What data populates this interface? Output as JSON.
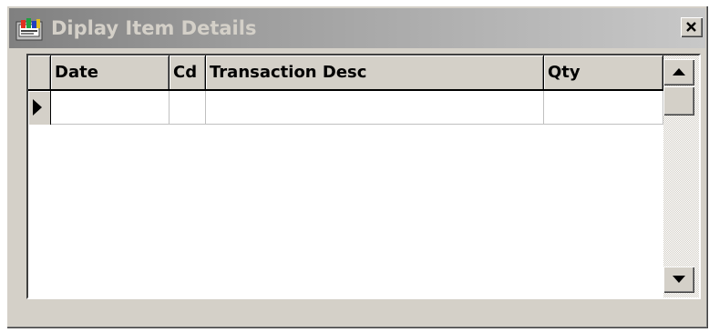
{
  "window": {
    "title": "Diplay Item Details",
    "icon": "app-icon",
    "close_label": "X"
  },
  "grid": {
    "columns": [
      {
        "key": "date",
        "label": "Date"
      },
      {
        "key": "cd",
        "label": "Cd"
      },
      {
        "key": "transaction_desc",
        "label": "Transaction Desc"
      },
      {
        "key": "qty",
        "label": "Qty"
      }
    ],
    "rows": [
      {
        "date": "",
        "cd": "",
        "transaction_desc": "",
        "qty": ""
      }
    ],
    "current_row_indicator": "triangle-right-icon"
  },
  "scrollbar": {
    "up_icon": "arrow-up-icon",
    "down_icon": "arrow-down-icon"
  }
}
